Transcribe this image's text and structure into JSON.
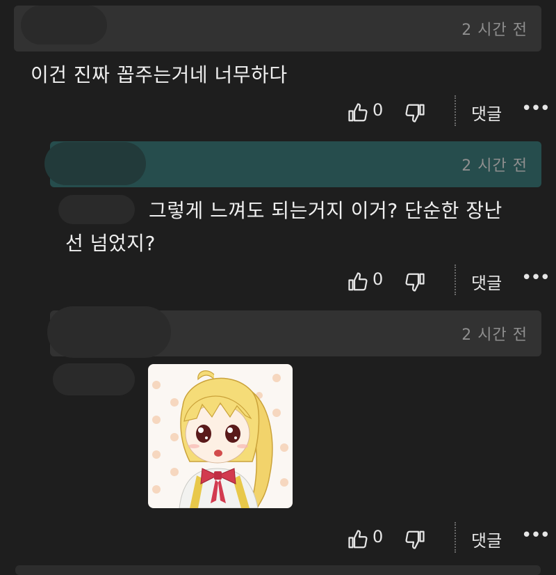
{
  "comments": [
    {
      "time": "2 시간 전",
      "text": "이건 진짜 꼽주는거네 너무하다",
      "likes": "0",
      "reply_label": "댓글",
      "more": "•••"
    },
    {
      "time": "2 시간 전",
      "text_line1": "그렇게 느껴도 되는거지 이거? 단순한 장난",
      "text_line2": "선 넘었지?",
      "likes": "0",
      "reply_label": "댓글",
      "more": "•••"
    },
    {
      "time": "2 시간 전",
      "likes": "0",
      "reply_label": "댓글",
      "more": "•••"
    }
  ],
  "colors": {
    "background": "#1e1e1e",
    "header_bar": "#323232",
    "highlight_bar": "#264d4d"
  },
  "icons": [
    "thumbs-up-icon",
    "thumbs-down-icon",
    "more-icon"
  ]
}
